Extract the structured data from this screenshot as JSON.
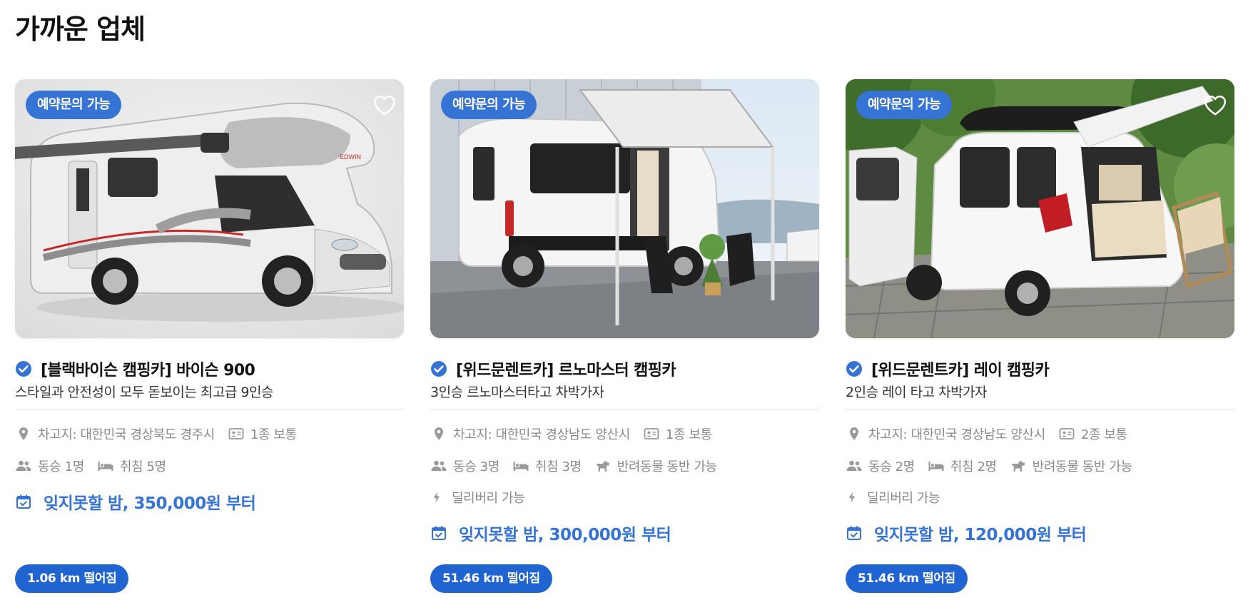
{
  "page": {
    "title": "가까운 업체"
  },
  "colors": {
    "accent": "#3574d4",
    "distance_bg": "#1f64d0",
    "muted": "#8a8a8a"
  },
  "cards": [
    {
      "badge": "예약문의 가능",
      "title": "[블랙바이슨 캠핑카] 바이슨 900",
      "subtitle": "스타일과 안전성이 모두 돋보이는 최고급 9인승",
      "location": "차고지: 대한민국 경상북도 경주시",
      "license": "1종 보통",
      "passengers": "동승 1명",
      "sleeps": "취침 5명",
      "price": "잊지못할 밤, 350,000원 부터",
      "distance": "1.06 km 떨어짐",
      "icons": [
        "check-badge-icon",
        "location-pin-icon",
        "id-card-icon",
        "people-icon",
        "bed-icon",
        "calendar-check-icon",
        "heart-outline-icon"
      ]
    },
    {
      "badge": "예약문의 가능",
      "title": "[위드문렌트카] 르노마스터 캠핑카",
      "subtitle": "3인승 르노마스터타고 차박가자",
      "location": "차고지: 대한민국 경상남도 양산시",
      "license": "1종 보통",
      "passengers": "동승 3명",
      "sleeps": "취침 3명",
      "pet": "반려동물 동반 가능",
      "delivery": "딜리버리 가능",
      "price": "잊지못할 밤, 300,000원 부터",
      "distance": "51.46 km 떨어짐",
      "icons": [
        "check-badge-icon",
        "location-pin-icon",
        "id-card-icon",
        "people-icon",
        "bed-icon",
        "dog-icon",
        "bolt-icon",
        "calendar-check-icon"
      ]
    },
    {
      "badge": "예약문의 가능",
      "title": "[위드문렌트카] 레이 캠핑카",
      "subtitle": "2인승 레이 타고 차박가자",
      "location": "차고지: 대한민국 경상남도 양산시",
      "license": "2종 보통",
      "passengers": "동승 2명",
      "sleeps": "취침 2명",
      "pet": "반려동물 동반 가능",
      "delivery": "딜리버리 가능",
      "price": "잊지못할 밤, 120,000원 부터",
      "distance": "51.46 km 떨어짐",
      "icons": [
        "check-badge-icon",
        "location-pin-icon",
        "id-card-icon",
        "people-icon",
        "bed-icon",
        "dog-icon",
        "bolt-icon",
        "calendar-check-icon",
        "heart-outline-icon"
      ]
    }
  ]
}
